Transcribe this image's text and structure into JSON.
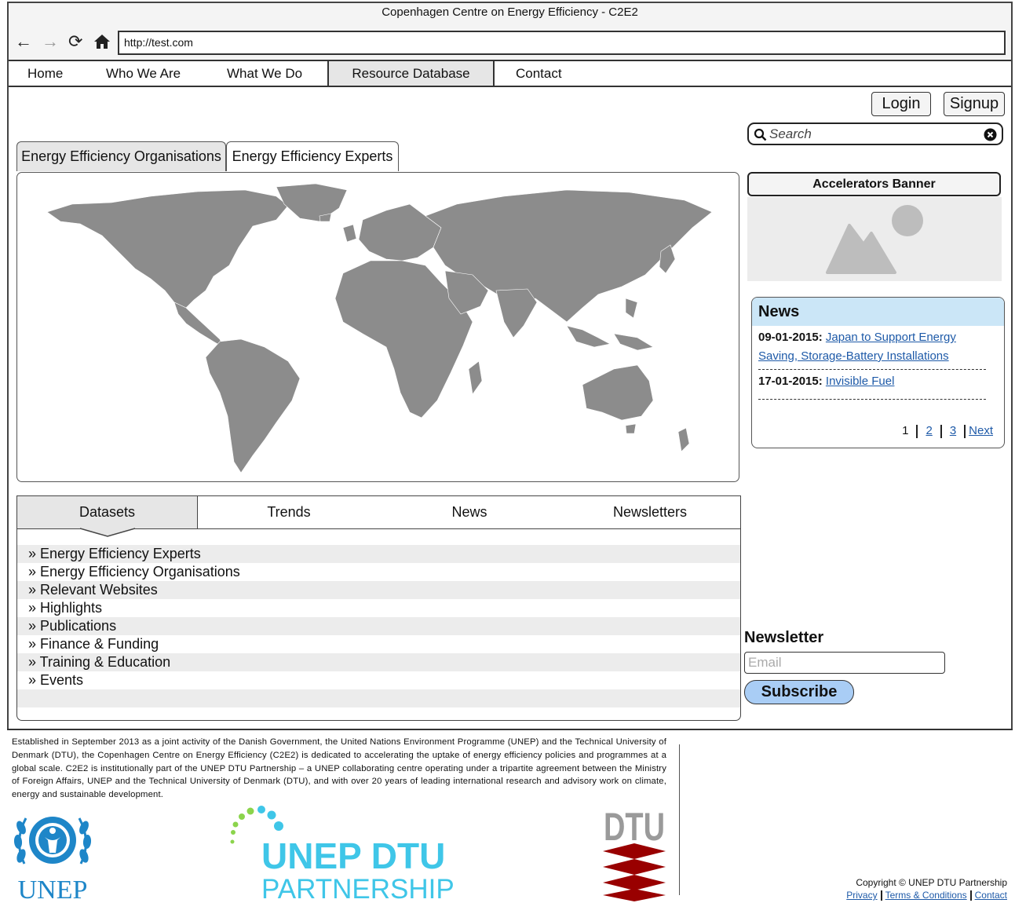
{
  "window": {
    "title": "Copenhagen Centre on Energy Efficiency - C2E2"
  },
  "browser": {
    "url": "http://test.com"
  },
  "menu": {
    "items": [
      "Home",
      "Who We Are",
      "What We Do",
      "Resource Database",
      "Contact"
    ],
    "active": "Resource Database"
  },
  "auth": {
    "login_label": "Login",
    "signup_label": "Signup"
  },
  "search": {
    "placeholder": "Search"
  },
  "map_tabs": [
    "Energy Efficiency Organisations",
    "Energy Efficiency Experts"
  ],
  "content_tabs": {
    "items": [
      "Datasets",
      "Trends",
      "News",
      "Newsletters"
    ],
    "active": "Datasets"
  },
  "dataset_links": [
    "» Energy Efficiency Experts",
    "» Energy Efficiency Organisations",
    "» Relevant Websites",
    "» Highlights",
    "» Publications",
    "» Finance & Funding",
    "» Training & Education",
    "» Events"
  ],
  "banner": {
    "label": "Accelerators Banner",
    "icon": "image-placeholder-icon"
  },
  "news": {
    "title": "News",
    "items": [
      {
        "date": "09-01-2015:",
        "headline": "Japan to Support Energy Saving, Storage-Battery Installations"
      },
      {
        "date": "17-01-2015:",
        "headline": "Invisible Fuel"
      }
    ],
    "pager": {
      "current": "1",
      "pages": [
        "2",
        "3"
      ],
      "next": "Next"
    }
  },
  "newsletter": {
    "title": "Newsletter",
    "email_placeholder": "Email",
    "subscribe_label": "Subscribe"
  },
  "footer": {
    "text": "Established in September 2013 as a joint activity of the Danish Government, the United Nations Environment Programme (UNEP) and the Technical University of Denmark (DTU), the Copenhagen Centre on Energy Efficiency (C2E2) is dedicated to accelerating the uptake of energy efficiency policies and programmes at a global scale. C2E2 is institutionally part of the UNEP DTU Partnership – a UNEP collaborating centre operating under a tripartite agreement between the Ministry of Foreign Affairs, UNEP and the Technical University of Denmark (DTU), and with over 20 years of leading international research and advisory work on climate, energy and sustainable development.",
    "logos": {
      "unep": "UNEP",
      "partnership_line1": "UNEP DTU",
      "partnership_line2": "PARTNERSHIP",
      "dtu": "DTU"
    },
    "copyright": "Copyright © UNEP DTU Partnership",
    "links": [
      "Privacy",
      "Terms & Conditions",
      "Contact"
    ]
  },
  "colors": {
    "map_land": "#8c8c8c",
    "news_header": "#cbe6f7",
    "subscribe": "#a9cdf5",
    "link": "#1e5aa8",
    "partnership_cyan": "#3fc6e8",
    "unep_blue": "#1e86c8",
    "dtu_red": "#990000"
  }
}
